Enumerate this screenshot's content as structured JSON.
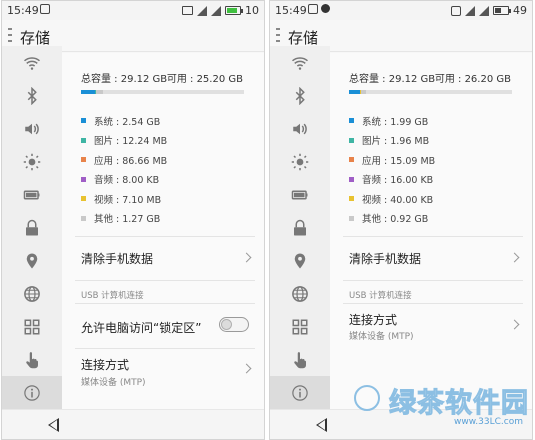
{
  "page_title": "存储",
  "colors": {
    "system": "#1a8fd6",
    "pictures": "#3fb5a4",
    "apps": "#e8834a",
    "audio": "#a05ec6",
    "video": "#e8c230",
    "other": "#c9c9c9",
    "toggle_off": "#dcdcdc",
    "watermark": "#8cbfe3"
  },
  "left": {
    "status": {
      "time": "15:49",
      "battery_text": "10",
      "battery_color": "#3fbf3f",
      "battery_level": 0.8
    },
    "title": "存储",
    "total_label": "总容量 : 29.12 GB",
    "available_label": "可用 : 25.20 GB",
    "usage_fractions": {
      "system": 0.087,
      "pictures": 0.004,
      "apps": 0.003,
      "audio": 0.0,
      "video": 0.0,
      "other": 0.044
    },
    "legend": [
      {
        "key": "system",
        "label": "系统 : 2.54 GB"
      },
      {
        "key": "pictures",
        "label": "图片 : 12.24 MB"
      },
      {
        "key": "apps",
        "label": "应用 : 86.66 MB"
      },
      {
        "key": "audio",
        "label": "音频 : 8.00 KB"
      },
      {
        "key": "video",
        "label": "视频 : 7.10 MB"
      },
      {
        "key": "other",
        "label": "其他 : 1.27 GB"
      }
    ],
    "clear_data": "清除手机数据",
    "usb_section": "USB 计算机连接",
    "allow_lock_area": "允许电脑访问“锁定区”",
    "allow_lock_area_enabled": false,
    "connection_mode": "连接方式",
    "connection_mode_value": "媒体设备 (MTP)"
  },
  "right": {
    "status": {
      "time": "15:49",
      "battery_text": "49",
      "battery_color": "#444444",
      "battery_level": 0.49
    },
    "title": "存储",
    "total_label": "总容量 : 29.12 GB",
    "available_label": "可用 : 26.20 GB",
    "usage_fractions": {
      "system": 0.068,
      "pictures": 0.001,
      "apps": 0.001,
      "audio": 0.0,
      "video": 0.001,
      "other": 0.032
    },
    "legend": [
      {
        "key": "system",
        "label": "系统 : 1.99 GB"
      },
      {
        "key": "pictures",
        "label": "图片 : 1.96 MB"
      },
      {
        "key": "apps",
        "label": "应用 : 15.09 MB"
      },
      {
        "key": "audio",
        "label": "音频 : 16.00 KB"
      },
      {
        "key": "video",
        "label": "视频 : 40.00 KB"
      },
      {
        "key": "other",
        "label": "其他 : 0.92 GB"
      }
    ],
    "clear_data": "清除手机数据",
    "usb_section": "USB 计算机连接",
    "connection_mode": "连接方式",
    "connection_mode_value": "媒体设备 (MTP)"
  },
  "sidebar_icons": [
    "wifi-icon",
    "bluetooth-icon",
    "volume-icon",
    "brightness-icon",
    "battery-icon",
    "lock-icon",
    "location-icon",
    "globe-icon",
    "apps-grid-icon",
    "touch-icon",
    "info-icon"
  ],
  "sidebar_active": "info-icon",
  "watermark": {
    "text": "绿茶软件园",
    "url": "www.33LC.com"
  }
}
